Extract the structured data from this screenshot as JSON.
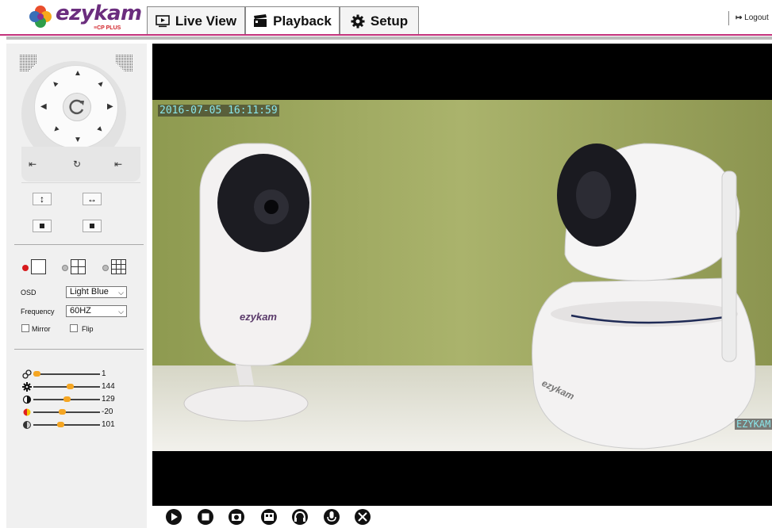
{
  "app": {
    "brand": "ezykam",
    "sub_brand": "≡CP PLUS"
  },
  "tabs": [
    {
      "label": "Live View",
      "icon": "monitor-icon"
    },
    {
      "label": "Playback",
      "icon": "clapperboard-icon"
    },
    {
      "label": "Setup",
      "icon": "gear-icon"
    }
  ],
  "header": {
    "logout_label": "Logout"
  },
  "controls": {
    "osd_label": "OSD",
    "osd_value": "Light Blue",
    "frequency_label": "Frequency",
    "frequency_value": "60HZ",
    "mirror_label": "Mirror",
    "flip_label": "Flip",
    "layout_options": [
      "single-view",
      "quad-view",
      "nine-view"
    ],
    "layout_selected": "single-view"
  },
  "sliders": [
    {
      "name": "zoom",
      "icon": "link-icon",
      "value": "1",
      "level": 0.0
    },
    {
      "name": "brightness",
      "icon": "sun-icon",
      "value": "144",
      "level": 0.56
    },
    {
      "name": "contrast",
      "icon": "contrast-icon",
      "value": "129",
      "level": 0.5
    },
    {
      "name": "hue",
      "icon": "color-icon",
      "value": "-20",
      "level": 0.42
    },
    {
      "name": "saturation",
      "icon": "saturation-icon",
      "value": "101",
      "level": 0.4
    }
  ],
  "video": {
    "timestamp": "2016-07-05 16:11:59",
    "camera_name": "EZYKAM"
  },
  "toolbar": [
    "play-icon",
    "stop-icon",
    "snapshot-icon",
    "record-icon",
    "listen-icon",
    "talk-icon",
    "fullscreen-icon"
  ],
  "colors": {
    "accent": "#c3327c",
    "slider_knob": "#f5a623",
    "osd_text": "#8ae6ea"
  }
}
